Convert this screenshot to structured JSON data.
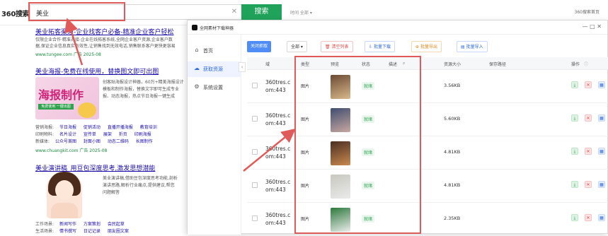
{
  "search": {
    "logo": "360搜索",
    "query": "美业",
    "button": "搜索",
    "filters": "时间  全部 ▾",
    "account": "360搜索首页"
  },
  "results": [
    {
      "title": "美业拓客渠道-企业找客户必备-精准企业客户轻松",
      "lines": [
        "仅限企业合作·精准对接-企业在线拓客系统,全网企业客户资源,企业客户数",
        "据,保证企业信息真实有效性,让销售找到无效电话,销售联系客户更快更容易"
      ],
      "url": "www.tungee.com  广告  2025-08"
    },
    {
      "title": "美业海报-免费在线使用，替换图文即可出图",
      "lines": [
        "创客贴海报设计神器，60万+精美海报设计",
        "模板和制作海报，替换文字即可生成专业",
        "报、动态海报，热点节日海报一键生成"
      ],
      "url": "www.chuangkit.com  广告  2025-08",
      "poster_text": "海报制作",
      "poster_sub": "免费使用 一键出图",
      "link_rows": [
        [
          "营销海报:",
          "节日海报",
          "促销活动",
          "直播开播海报",
          "教育培训"
        ],
        [
          "印刷物料:",
          "名片设计",
          "宣传单",
          "展架",
          "折页",
          "印刷海报"
        ],
        [
          "新媒体:",
          "公众号首图",
          "封面小图",
          "动态二维码",
          "长图制作"
        ]
      ]
    },
    {
      "title": "美业演讲稿_用豆包深度思考,激发思想潜能",
      "lines": [
        "美业演讲稿,借助豆包深度思考功能,剖析",
        "演讲思路,解析行业痛点,提供建议,帮您",
        "问题解答"
      ],
      "link_rows": [
        [
          "工作场景:",
          "新闻写作",
          "方案策划",
          "会民起草"
        ],
        [
          "生活场景:",
          "情书撰写",
          "日记记录",
          "朋友圈文案"
        ]
      ]
    }
  ],
  "downloader": {
    "title": "全网素材下载神器",
    "window_controls": "— □ ✕",
    "sidebar": [
      {
        "icon": "home-icon",
        "label": "首页"
      },
      {
        "icon": "cloud-icon",
        "label": "获取资源"
      },
      {
        "icon": "gear-icon",
        "label": "系统设置"
      }
    ],
    "toolbar": {
      "fetch": "关闭抓取",
      "select": "全部  ▾",
      "clear": "清空列表",
      "batch_download": "批量下载",
      "batch_export": "批量导出",
      "batch_import": "批量导入"
    },
    "columns": {
      "domain": "域",
      "type": "类型",
      "preview": "预览",
      "status": "状态",
      "desc": "描述",
      "size": "资源大小",
      "path": "保存路径",
      "actions": "操作"
    },
    "rows": [
      {
        "domain": "360tres.c\nom:443",
        "type": "图片",
        "status": "就绪",
        "size": "3.56KB",
        "thumb": [
          "#6b4a34",
          "#d9b98a"
        ]
      },
      {
        "domain": "360tres.c\nom:443",
        "type": "图片",
        "status": "就绪",
        "size": "5.60KB",
        "thumb": [
          "#3f4d70",
          "#c9a8a0"
        ]
      },
      {
        "domain": "360tres.c\nom:443",
        "type": "图片",
        "status": "就绪",
        "size": "4.81KB",
        "thumb": [
          "#4a2e22",
          "#c9894d"
        ]
      },
      {
        "domain": "360tres.c\nom:443",
        "type": "图片",
        "status": "就绪",
        "size": "4.81KB",
        "thumb": [
          "#c8c8c0",
          "#eaeaea"
        ]
      },
      {
        "domain": "360tres.c\nom:443",
        "type": "图片",
        "status": "就绪",
        "size": "2.35KB",
        "thumb": [
          "#2c7a3c",
          "#ececec"
        ]
      }
    ]
  }
}
